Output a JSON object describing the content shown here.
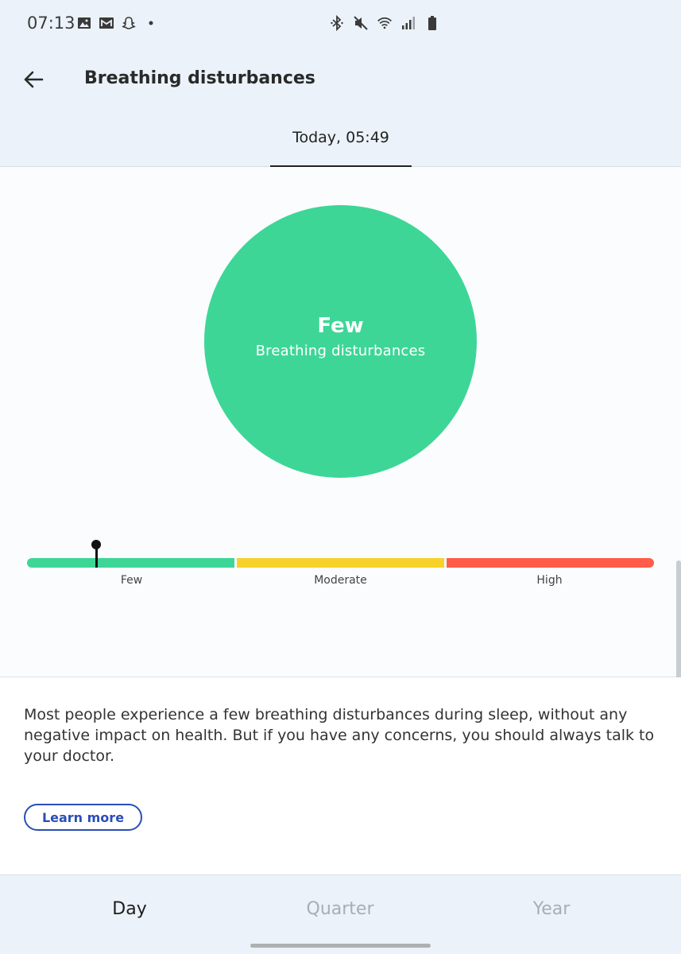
{
  "status_bar": {
    "time": "07:13",
    "left_icons": [
      "image-icon",
      "mail-icon",
      "snapchat-icon",
      "dot-icon"
    ],
    "right_icons": [
      "bluetooth-icon",
      "mute-icon",
      "wifi-icon",
      "signal-icon",
      "battery-icon"
    ]
  },
  "header": {
    "title": "Breathing disturbances",
    "back_icon": "arrow-left-icon",
    "date_tab": "Today, 05:49"
  },
  "score": {
    "value": "Few",
    "label": "Breathing disturbances",
    "circle_color": "#3dd696"
  },
  "scale": {
    "labels": [
      "Few",
      "Moderate",
      "High"
    ],
    "colors": [
      "#3dd696",
      "#f7d22a",
      "#ff5c4a"
    ]
  },
  "info": {
    "text": "Most people experience a few breathing disturbances during sleep, without any negative impact on health. But if you have any concerns, you should always talk to your doctor.",
    "learn_more": "Learn more",
    "accent_color": "#2a4db8"
  },
  "bottom_nav": {
    "items": [
      "Day",
      "Quarter",
      "Year"
    ],
    "selected": "Day"
  }
}
